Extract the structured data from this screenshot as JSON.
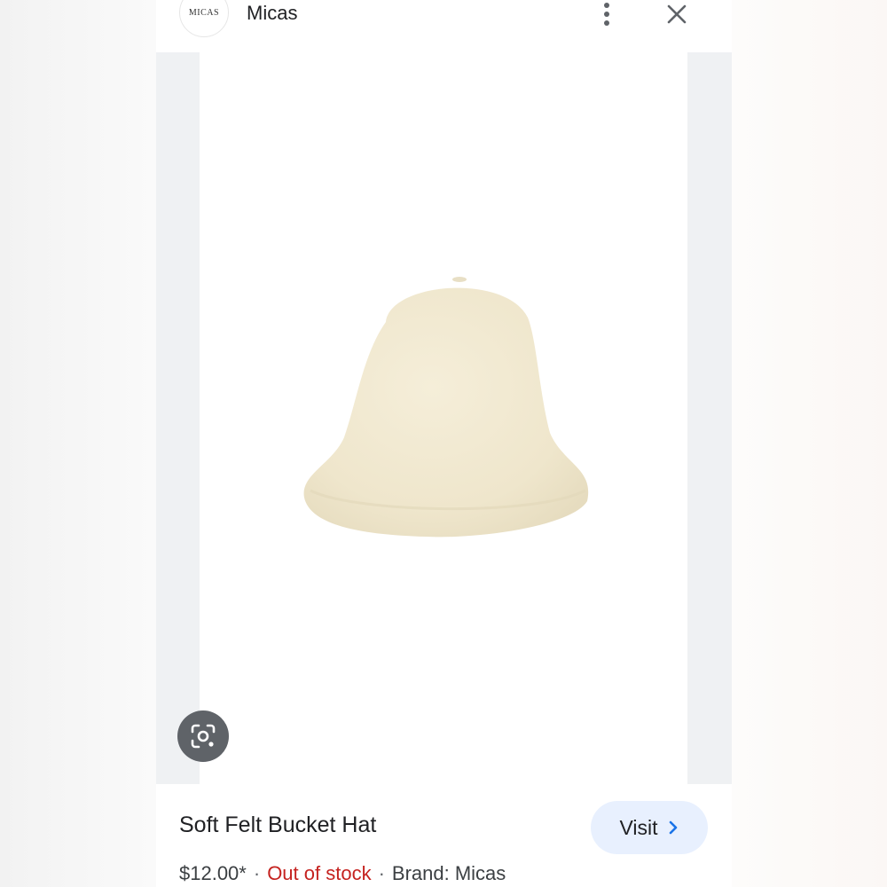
{
  "header": {
    "logo_text": "MICAS",
    "site_name": "Micas"
  },
  "product": {
    "title": "Soft Felt Bucket Hat",
    "price": "$12.00*",
    "separator": "·",
    "stock_status": "Out of stock",
    "brand": "Brand: Micas",
    "visit_label": "Visit"
  },
  "colors": {
    "stock_red": "#c5221f",
    "visit_bg": "#e8f0fe",
    "visit_chevron": "#1a73e8",
    "hat_color": "#f1e9d2"
  },
  "icons": {
    "more": "more-vert-icon",
    "close": "close-icon",
    "lens": "google-lens-icon",
    "chevron": "chevron-right-icon"
  }
}
